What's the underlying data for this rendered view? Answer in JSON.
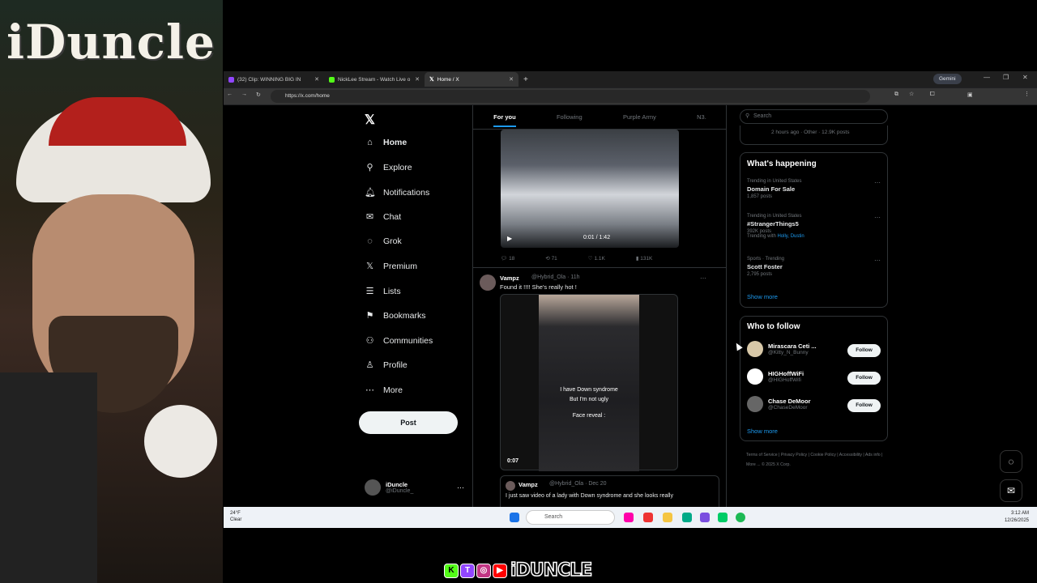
{
  "stream_overlay": {
    "banner_text": "iDuncle",
    "brand_text": "iDUNCLE",
    "brand_icons": [
      "K",
      "T",
      "◎",
      "▶"
    ]
  },
  "browser": {
    "tabs": [
      {
        "title": "(32) Clip: WINNING BIG IN",
        "color": "#9146ff"
      },
      {
        "title": "NickLee Stream - Watch Live o",
        "color": "#53fc18"
      },
      {
        "title": "Home / X",
        "color": "#ffffff"
      }
    ],
    "new_tab": "+",
    "gemini": "Gemini",
    "url": "https://x.com/home"
  },
  "x": {
    "logo": "𝕏",
    "nav": [
      {
        "label": "Home",
        "icon": "⌂"
      },
      {
        "label": "Explore",
        "icon": "⚲"
      },
      {
        "label": "Notifications",
        "icon": "🔔︎"
      },
      {
        "label": "Chat",
        "icon": "✉"
      },
      {
        "label": "Grok",
        "icon": "◌"
      },
      {
        "label": "Premium",
        "icon": "𝕏"
      },
      {
        "label": "Lists",
        "icon": "☰"
      },
      {
        "label": "Bookmarks",
        "icon": "⚑"
      },
      {
        "label": "Communities",
        "icon": "⚇"
      },
      {
        "label": "Profile",
        "icon": "♙"
      },
      {
        "label": "More",
        "icon": "⋯"
      }
    ],
    "post_button": "Post",
    "me": {
      "name": "iDuncle",
      "handle": "@iDuncle_",
      "more": "⋯"
    },
    "feed_tabs": [
      "For you",
      "Following",
      "Purple Army",
      "N3."
    ],
    "video1": {
      "time": "0:01 / 1:42"
    },
    "actions1": [
      "18",
      "71",
      "1.1K",
      "131K"
    ],
    "post2": {
      "name": "Vampz",
      "handle": "@Hybrid_Ola · 11h",
      "text": "Found it !!!! She's really hot !",
      "caption1": "I have Down syndrome",
      "caption2": "But I'm not ugly",
      "caption3": "Face reveal :",
      "time": "0:07"
    },
    "quote": {
      "name": "Vampz",
      "handle": "@Hybrid_Ola · Dec 20",
      "text": "I just saw video of a lady with Down syndrome and she looks really"
    },
    "search_placeholder": "Search",
    "prev_meta": "2 hours ago · Other · 12.9K posts",
    "happening": {
      "title": "What's happening",
      "items": [
        {
          "context": "Trending in United States",
          "topic": "Domain For Sale",
          "count": "1,857 posts"
        },
        {
          "context": "Trending in United States",
          "topic": "#StrangerThings5",
          "count": "392K posts",
          "with_prefix": "Trending with",
          "with": "Holly, Dustin"
        },
        {
          "context": "Sports · Trending",
          "topic": "Scott Foster",
          "count": "2,795 posts"
        }
      ],
      "show_more": "Show more"
    },
    "who_to_follow": {
      "title": "Who to follow",
      "users": [
        {
          "name": "Mirascara Ceti ...",
          "handle": "@Kitty_N_Bunny"
        },
        {
          "name": "HIGHoffWiFi",
          "handle": "@HIGHoffWifi"
        },
        {
          "name": "Chase DeMoor",
          "handle": "@ChaseDeMoor"
        }
      ],
      "follow_label": "Follow",
      "show_more": "Show more"
    },
    "footer": "Terms of Service  |  Privacy Policy  |  Cookie Policy  |  Accessibility  |  Ads info  |  More ...  © 2025 X Corp."
  },
  "taskbar": {
    "weather_temp": "24°F",
    "weather_cond": "Clear",
    "search": "Search",
    "time": "3:12 AM",
    "date": "12/26/2025"
  }
}
